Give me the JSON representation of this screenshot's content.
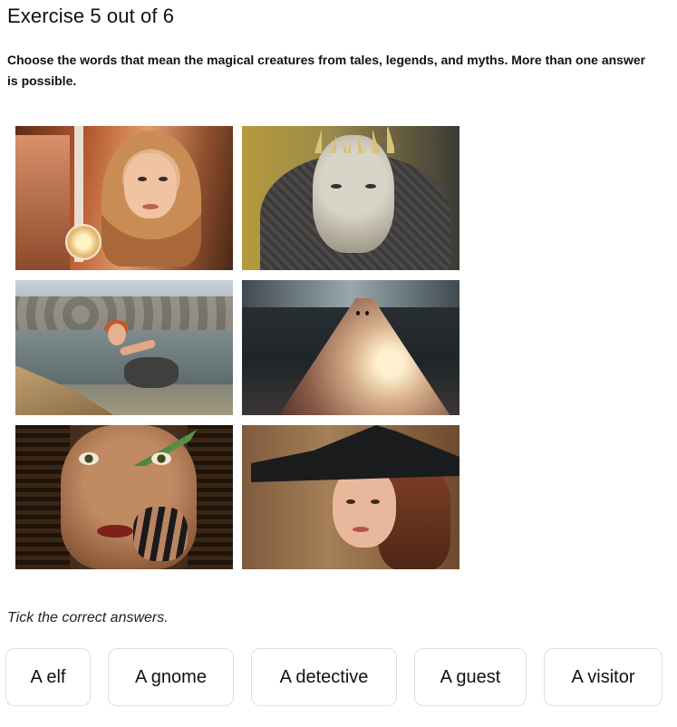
{
  "exercise": {
    "title": "Exercise 5 out of 6",
    "instruction": "Choose the words that mean the magical creatures from tales, legends, and myths. More than one answer is possible."
  },
  "images": [
    {
      "name": "photo-elf-woman-with-lantern"
    },
    {
      "name": "photo-spiked-creature"
    },
    {
      "name": "photo-woman-in-water"
    },
    {
      "name": "photo-ghost-sheet"
    },
    {
      "name": "photo-elf-with-green-makeup"
    },
    {
      "name": "photo-witch-hat-woman"
    }
  ],
  "prompt": "Tick the correct answers.",
  "options": [
    "A elf",
    "A gnome",
    "A detective",
    "A guest",
    "A visitor"
  ]
}
